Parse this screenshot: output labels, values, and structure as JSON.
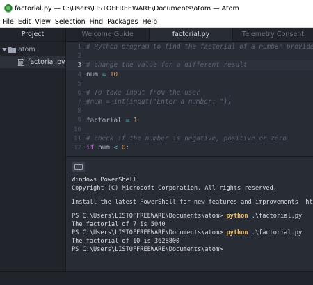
{
  "window": {
    "title": "factorial.py — C:\\Users\\LISTOFFREEWARE\\Documents\\atom — Atom"
  },
  "menu": [
    "File",
    "Edit",
    "View",
    "Selection",
    "Find",
    "Packages",
    "Help"
  ],
  "sidebar": {
    "header": "Project",
    "root_folder": "atom",
    "files": [
      "factorial.py"
    ]
  },
  "tabs": [
    {
      "label": "Welcome Guide",
      "active": false
    },
    {
      "label": "factorial.py",
      "active": true
    },
    {
      "label": "Telemetry Consent",
      "active": false
    }
  ],
  "editor": {
    "cursor_line": 3,
    "lines": [
      {
        "n": "1",
        "tokens": [
          {
            "t": "# Python program to find the factorial of a number provided by the user.",
            "c": "cm"
          }
        ]
      },
      {
        "n": "2",
        "tokens": []
      },
      {
        "n": "3",
        "tokens": [
          {
            "t": "# change the value for a different result",
            "c": "cm"
          }
        ]
      },
      {
        "n": "4",
        "tokens": [
          {
            "t": "num ",
            "c": ""
          },
          {
            "t": "=",
            "c": "op"
          },
          {
            "t": " ",
            "c": ""
          },
          {
            "t": "10",
            "c": "num"
          }
        ]
      },
      {
        "n": "5",
        "tokens": []
      },
      {
        "n": "6",
        "tokens": [
          {
            "t": "# To take input from the user",
            "c": "cm"
          }
        ]
      },
      {
        "n": "7",
        "tokens": [
          {
            "t": "#num = int(input(\"Enter a number: \"))",
            "c": "cm"
          }
        ]
      },
      {
        "n": "8",
        "tokens": []
      },
      {
        "n": "9",
        "tokens": [
          {
            "t": "factorial ",
            "c": ""
          },
          {
            "t": "=",
            "c": "op"
          },
          {
            "t": " ",
            "c": ""
          },
          {
            "t": "1",
            "c": "num"
          }
        ]
      },
      {
        "n": "10",
        "tokens": []
      },
      {
        "n": "11",
        "tokens": [
          {
            "t": "# check if the number is negative, positive or zero",
            "c": "cm"
          }
        ]
      },
      {
        "n": "12",
        "tokens": [
          {
            "t": "if",
            "c": "kw"
          },
          {
            "t": " num ",
            "c": ""
          },
          {
            "t": "<",
            "c": "op"
          },
          {
            "t": " ",
            "c": ""
          },
          {
            "t": "0",
            "c": "num"
          },
          {
            "t": ":",
            "c": ""
          }
        ]
      }
    ]
  },
  "terminal": {
    "lines": [
      {
        "segs": [
          {
            "t": "Windows PowerShell"
          }
        ]
      },
      {
        "segs": [
          {
            "t": "Copyright (C) Microsoft Corporation. All rights reserved."
          }
        ]
      },
      {
        "blank": true
      },
      {
        "segs": [
          {
            "t": "Install the latest PowerShell for new features and improvements! https://aka.ms/PSWindows"
          }
        ]
      },
      {
        "blank": true
      },
      {
        "segs": [
          {
            "t": "PS C:\\Users\\LISTOFFREEWARE\\Documents\\atom> "
          },
          {
            "t": "python",
            "c": "cmd"
          },
          {
            "t": " .\\factorial.py"
          }
        ]
      },
      {
        "segs": [
          {
            "t": "The factorial of 7 is 5040"
          }
        ]
      },
      {
        "segs": [
          {
            "t": "PS C:\\Users\\LISTOFFREEWARE\\Documents\\atom> "
          },
          {
            "t": "python",
            "c": "cmd"
          },
          {
            "t": " .\\factorial.py"
          }
        ]
      },
      {
        "segs": [
          {
            "t": "The factorial of 10 is 3628800"
          }
        ]
      },
      {
        "segs": [
          {
            "t": "PS C:\\Users\\LISTOFFREEWARE\\Documents\\atom>"
          }
        ]
      }
    ]
  },
  "colors": {
    "panel": "#21252b",
    "editor_bg": "#282c34",
    "comment": "#5c6370",
    "keyword": "#c678dd",
    "operator": "#56b6c2",
    "number": "#d19a66",
    "command": "#e5c07b"
  }
}
